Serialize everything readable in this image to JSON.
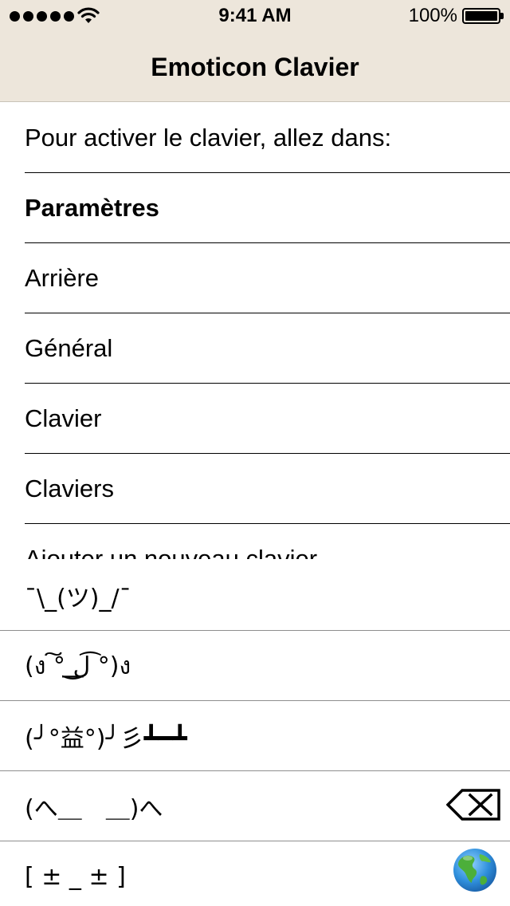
{
  "status_bar": {
    "time": "9:41 AM",
    "battery_percent": "100%",
    "signal_dots": 5,
    "icons": [
      "signal-dots-icon",
      "wifi-icon",
      "battery-icon"
    ]
  },
  "nav": {
    "title": "Emoticon Clavier"
  },
  "instructions": {
    "items": [
      {
        "label": "Pour activer le clavier, allez dans:"
      },
      {
        "label": "Paramètres"
      },
      {
        "label": "Arrière"
      },
      {
        "label": "Général"
      },
      {
        "label": "Clavier"
      },
      {
        "label": "Claviers"
      },
      {
        "label": "Ajouter un nouveau clavier"
      }
    ]
  },
  "keyboard": {
    "emoticons": [
      "¯\\_(ツ)_/¯",
      "(ง ͠° ͟ل͜ ͡°)ง",
      "(╯°益°)╯彡┻━┻",
      "(へ＿　＿)へ",
      "[ ± _ ± ]"
    ],
    "icons": [
      "backspace-icon",
      "globe-icon"
    ]
  },
  "colors": {
    "header_bg": "#ede6db",
    "separator": "#000000",
    "text": "#000000",
    "globe_ocean": "#2f8fdc",
    "globe_land": "#4caf3a"
  }
}
